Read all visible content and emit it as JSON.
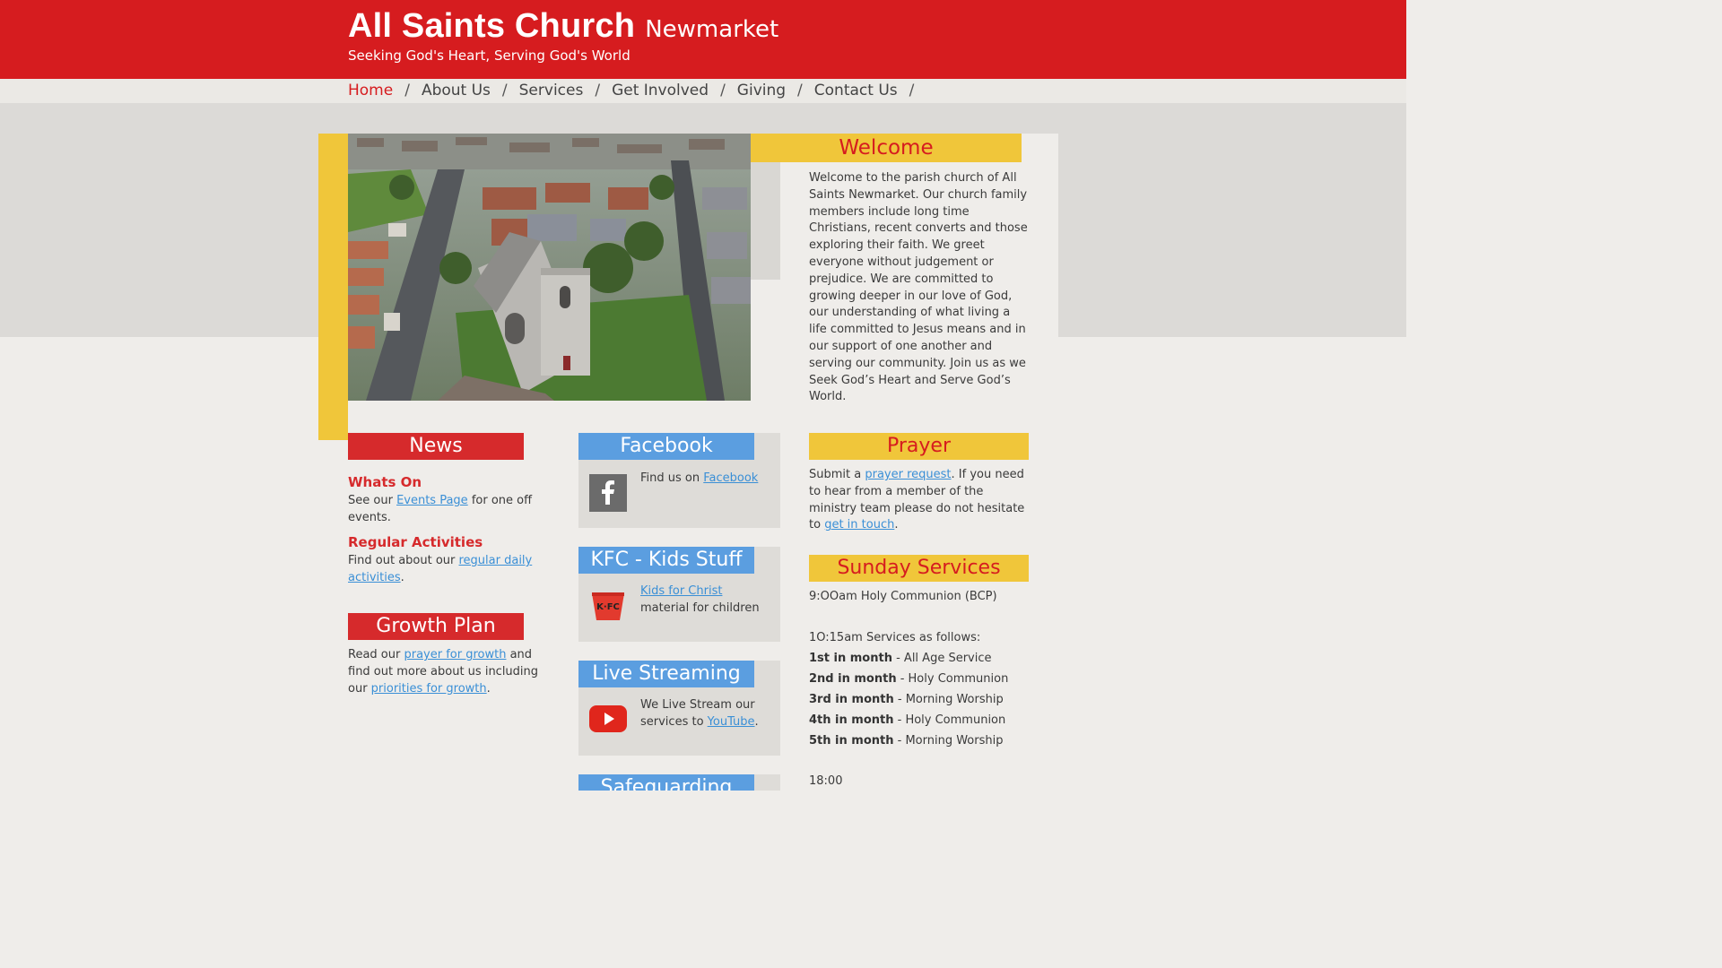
{
  "header": {
    "title": "All Saints Church",
    "subtitle": "Newmarket",
    "tagline": "Seeking God's Heart, Serving God's World"
  },
  "nav": {
    "items": [
      {
        "label": "Home",
        "active": true
      },
      {
        "label": "About Us"
      },
      {
        "label": "Services"
      },
      {
        "label": "Get Involved"
      },
      {
        "label": "Giving"
      },
      {
        "label": "Contact Us"
      }
    ],
    "separator": "/"
  },
  "welcome": {
    "heading": "Welcome",
    "text": "Welcome to the parish church of All Saints Newmarket. Our church family members include long time Christians, recent converts and those exploring their faith. We greet everyone without judgement or prejudice. We are committed to growing deeper in our love of God, our understanding of what living a life committed to Jesus means and in our support of one another and serving our community. Join us as we Seek God’s Heart and Serve God’s World."
  },
  "news": {
    "heading": "News",
    "whats_on": {
      "title": "Whats On",
      "pre": "See our ",
      "link": "Events Page",
      "post": " for one off events."
    },
    "regular": {
      "title": "Regular Activities",
      "pre": "Find out about our ",
      "link": "regular daily activities",
      "post": "."
    }
  },
  "growth": {
    "heading": "Growth Plan",
    "pre": "Read our ",
    "link1": "prayer for growth",
    "mid": " and find out more about us including our ",
    "link2": "priorities for growth",
    "post": "."
  },
  "facebook": {
    "heading": "Facebook",
    "pre": "Find us on ",
    "link": "Facebook",
    "icon": "facebook-icon"
  },
  "kfc": {
    "heading": "KFC - Kids Stuff",
    "link": "Kids for Christ",
    "post": " material for children",
    "badge": "K·FC",
    "icon": "kfc-bucket-icon"
  },
  "live": {
    "heading": "Live Streaming",
    "pre": "We Live Stream our services to ",
    "link": "YouTube",
    "post": ".",
    "icon": "youtube-icon"
  },
  "safeguarding": {
    "heading": "Safeguarding"
  },
  "prayer": {
    "heading": "Prayer",
    "pre": "Submit a ",
    "link1": "prayer request",
    "mid": ".  If you need to hear from a member of the ministry team please do not hesitate to ",
    "link2": "get in touch",
    "post": "."
  },
  "sunday": {
    "heading": "Sunday Services",
    "early": "9:OOam Holy Communion (BCP)",
    "main_intro": "1O:15am Services as follows:",
    "schedule": [
      {
        "week": "1st in month",
        "service": " - All Age Service"
      },
      {
        "week": "2nd in month",
        "service": " - Holy Communion"
      },
      {
        "week": "3rd in month",
        "service": " - Morning Worship"
      },
      {
        "week": "4th in month",
        "service": " - Holy Communion"
      },
      {
        "week": "5th in month",
        "service": " - Morning Worship"
      }
    ],
    "evening": "18:00"
  },
  "colors": {
    "brand_red": "#d61c1f",
    "accent_yellow": "#f0c63a",
    "accent_blue": "#5b9ee0",
    "link_blue": "#3a8fd6"
  }
}
